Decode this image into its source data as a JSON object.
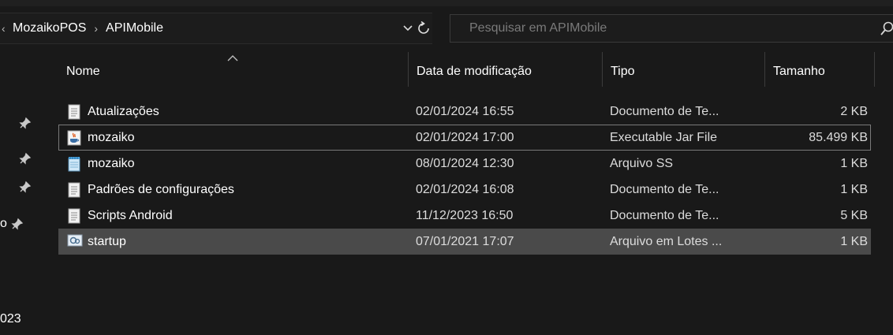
{
  "breadcrumb": {
    "items": [
      "MozaikoPOS",
      "APIMobile"
    ],
    "separator": "›",
    "leading_chevron": "‹"
  },
  "search": {
    "placeholder": "Pesquisar em APIMobile",
    "value": ""
  },
  "columns": {
    "name": "Nome",
    "date": "Data de modificação",
    "type": "Tipo",
    "size": "Tamanho"
  },
  "nav": {
    "partial_labels": [
      "o",
      "023"
    ]
  },
  "files": [
    {
      "name": "Atualizações",
      "date": "02/01/2024 16:55",
      "type": "Documento de Te...",
      "size": "2 KB",
      "icon": "text-document-icon",
      "state": "normal"
    },
    {
      "name": "mozaiko",
      "date": "02/01/2024 17:00",
      "type": "Executable Jar File",
      "size": "85.499 KB",
      "icon": "java-jar-icon",
      "state": "focused"
    },
    {
      "name": "mozaiko",
      "date": "08/01/2024 12:30",
      "type": "Arquivo SS",
      "size": "1 KB",
      "icon": "notepad-icon",
      "state": "normal"
    },
    {
      "name": "Padrões de configurações",
      "date": "02/01/2024 16:08",
      "type": "Documento de Te...",
      "size": "1 KB",
      "icon": "text-document-icon",
      "state": "normal"
    },
    {
      "name": "Scripts Android",
      "date": "11/12/2023 16:50",
      "type": "Documento de Te...",
      "size": "5 KB",
      "icon": "text-document-icon",
      "state": "normal"
    },
    {
      "name": "startup",
      "date": "07/01/2021 17:07",
      "type": "Arquivo em Lotes ...",
      "size": "1 KB",
      "icon": "batch-file-icon",
      "state": "selected"
    }
  ],
  "colors": {
    "background": "#191919",
    "selected_row": "#4a4a4a",
    "focus_border": "#7a7a7a"
  }
}
